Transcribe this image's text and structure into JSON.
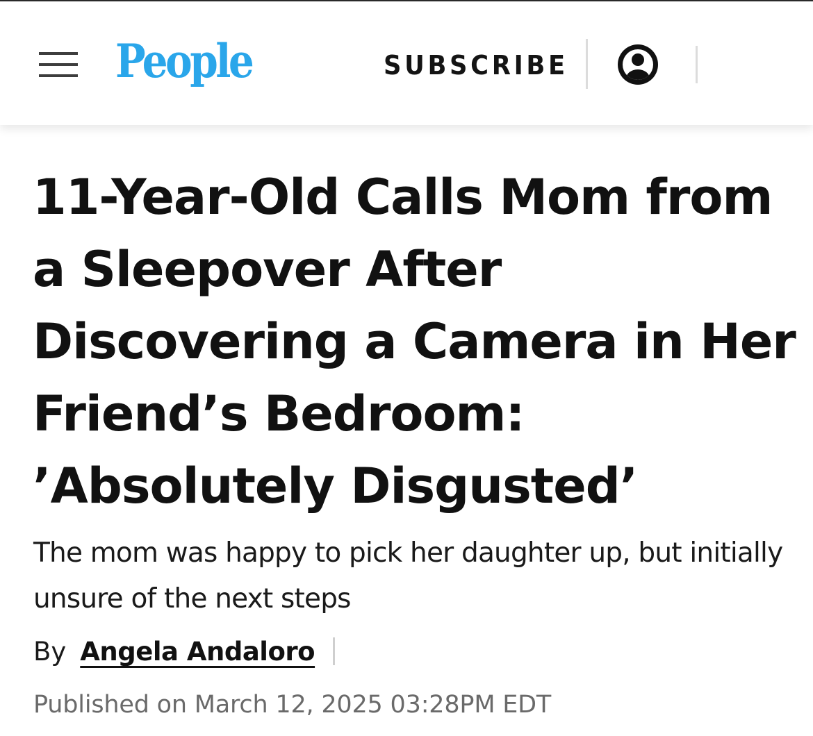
{
  "header": {
    "logo_text": "People",
    "subscribe_label": "SUBSCRIBE",
    "icons": {
      "menu": "hamburger-menu-icon",
      "account": "account-circle-icon"
    },
    "colors": {
      "logo": "#2aa6ea",
      "text": "#141414"
    }
  },
  "article": {
    "headline": "11-Year-Old Calls Mom from a Sleepover After Discovering a Camera in Her Friend’s Bedroom: ’Absolutely Disgusted’",
    "dek": "The mom was happy to pick her daughter up, but initially unsure of the next steps",
    "byline": {
      "prefix": "By",
      "author": "Angela Andaloro"
    },
    "published": "Published on March 12, 2025 03:28PM EDT"
  }
}
